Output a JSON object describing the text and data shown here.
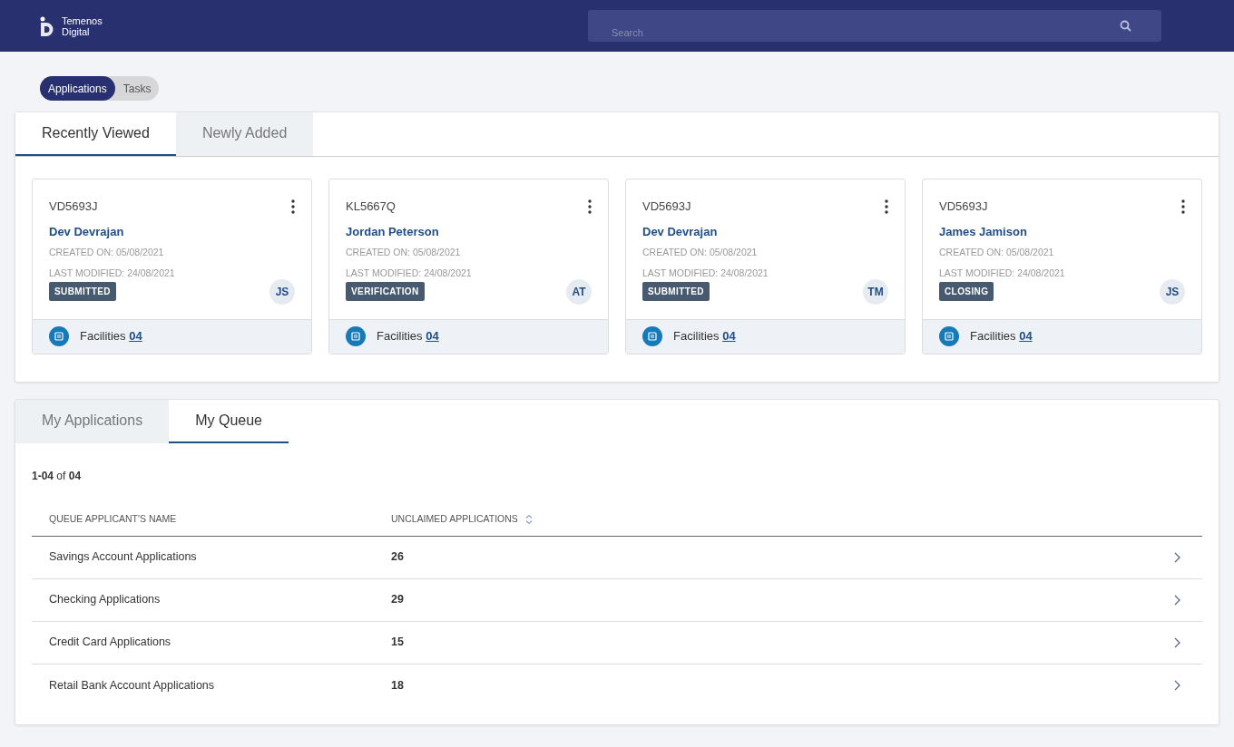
{
  "header": {
    "logo_lines": [
      "Temenos",
      "Digital"
    ],
    "search": {
      "placeholder": "Search"
    }
  },
  "view_toggle": [
    {
      "label": "Applications",
      "selected": true
    },
    {
      "label": "Tasks",
      "selected": false
    }
  ],
  "recent_tabs": [
    {
      "label": "Recently Viewed",
      "selected": true
    },
    {
      "label": "Newly Added",
      "selected": false
    }
  ],
  "cards": [
    {
      "id": "VD5693J",
      "name": "Dev Devrajan",
      "created": "CREATED ON: 05/08/2021",
      "modified": "LAST MODIFIED: 24/08/2021",
      "status": "SUBMITTED",
      "initials": "JS",
      "facilities_label": "Facilities",
      "facilities_count": "04"
    },
    {
      "id": "KL5667Q",
      "name": "Jordan Peterson",
      "created": "CREATED ON: 05/08/2021",
      "modified": "LAST MODIFIED: 24/08/2021",
      "status": "VERIFICATION",
      "initials": "AT",
      "facilities_label": "Facilities",
      "facilities_count": "04"
    },
    {
      "id": "VD5693J",
      "name": "Dev Devrajan",
      "created": "CREATED ON: 05/08/2021",
      "modified": "LAST MODIFIED: 24/08/2021",
      "status": "SUBMITTED",
      "initials": "TM",
      "facilities_label": "Facilities",
      "facilities_count": "04"
    },
    {
      "id": "VD5693J",
      "name": "James Jamison",
      "created": "CREATED ON: 05/08/2021",
      "modified": "LAST MODIFIED: 24/08/2021",
      "status": "CLOSING",
      "initials": "JS",
      "facilities_label": "Facilities",
      "facilities_count": "04"
    }
  ],
  "queue_tabs": [
    {
      "label": "My Applications",
      "selected": false
    },
    {
      "label": "My Queue",
      "selected": true
    }
  ],
  "range": "**1-04** of **04**",
  "table": {
    "columns": [
      "QUEUE APPLICANT'S NAME",
      "UNCLAIMED APPLICATIONS"
    ],
    "rows": [
      {
        "name": "Savings Account Applications",
        "count": "26"
      },
      {
        "name": "Checking Applications",
        "count": "29"
      },
      {
        "name": "Credit Card Applications",
        "count": "15"
      },
      {
        "name": "Retail Bank Account Applications",
        "count": "18"
      }
    ]
  }
}
